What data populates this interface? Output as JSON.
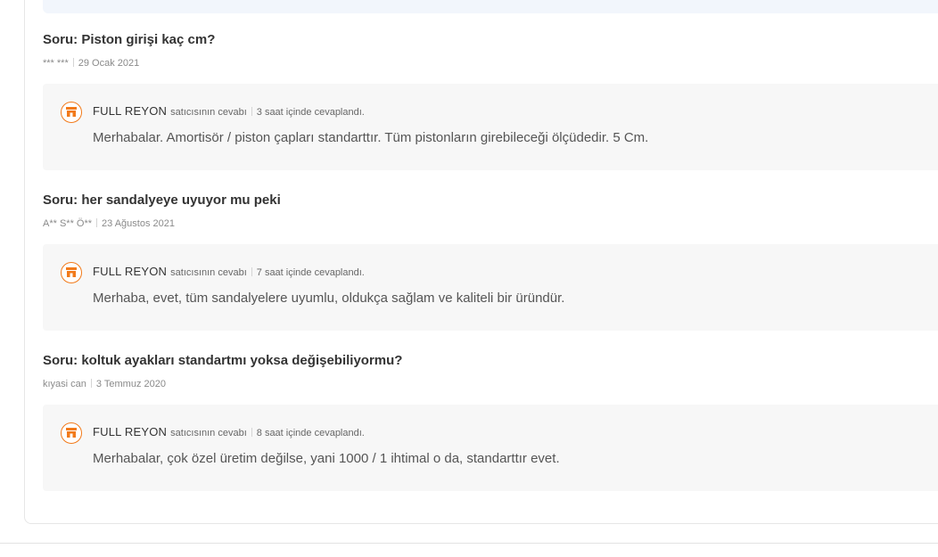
{
  "qa_list": [
    {
      "question": "Soru: Piston girişi kaç cm?",
      "author": "*** ***",
      "date": "29 Ocak 2021",
      "answer": {
        "seller": "FULL REYON",
        "seller_tag": "satıcısının cevabı",
        "time": "3 saat içinde cevaplandı.",
        "text": "Merhabalar. Amortisör / piston çapları standarttır. Tüm pistonların girebileceği ölçüdedir. 5 Cm."
      }
    },
    {
      "question": "Soru: her sandalyeye uyuyor mu peki",
      "author": "A** S** Ö**",
      "date": "23 Ağustos 2021",
      "answer": {
        "seller": "FULL REYON",
        "seller_tag": "satıcısının cevabı",
        "time": "7 saat içinde cevaplandı.",
        "text": "Merhaba, evet, tüm sandalyelere uyumlu, oldukça sağlam ve kaliteli bir üründür."
      }
    },
    {
      "question": "Soru: koltuk ayakları standartmı yoksa değişebiliyormu?",
      "author": "kıyasi can",
      "date": "3 Temmuz 2020",
      "answer": {
        "seller": "FULL REYON",
        "seller_tag": "satıcısının cevabı",
        "time": "8 saat içinde cevaplandı.",
        "text": "Merhabalar, çok özel üretim değilse, yani 1000 / 1 ihtimal o da, standarttır evet."
      }
    }
  ],
  "icons": {
    "seller": "store-icon"
  },
  "colors": {
    "accent": "#f27a1a",
    "answer_bg": "#f7f7f7",
    "top_strip_bg": "#f2f6fc"
  }
}
